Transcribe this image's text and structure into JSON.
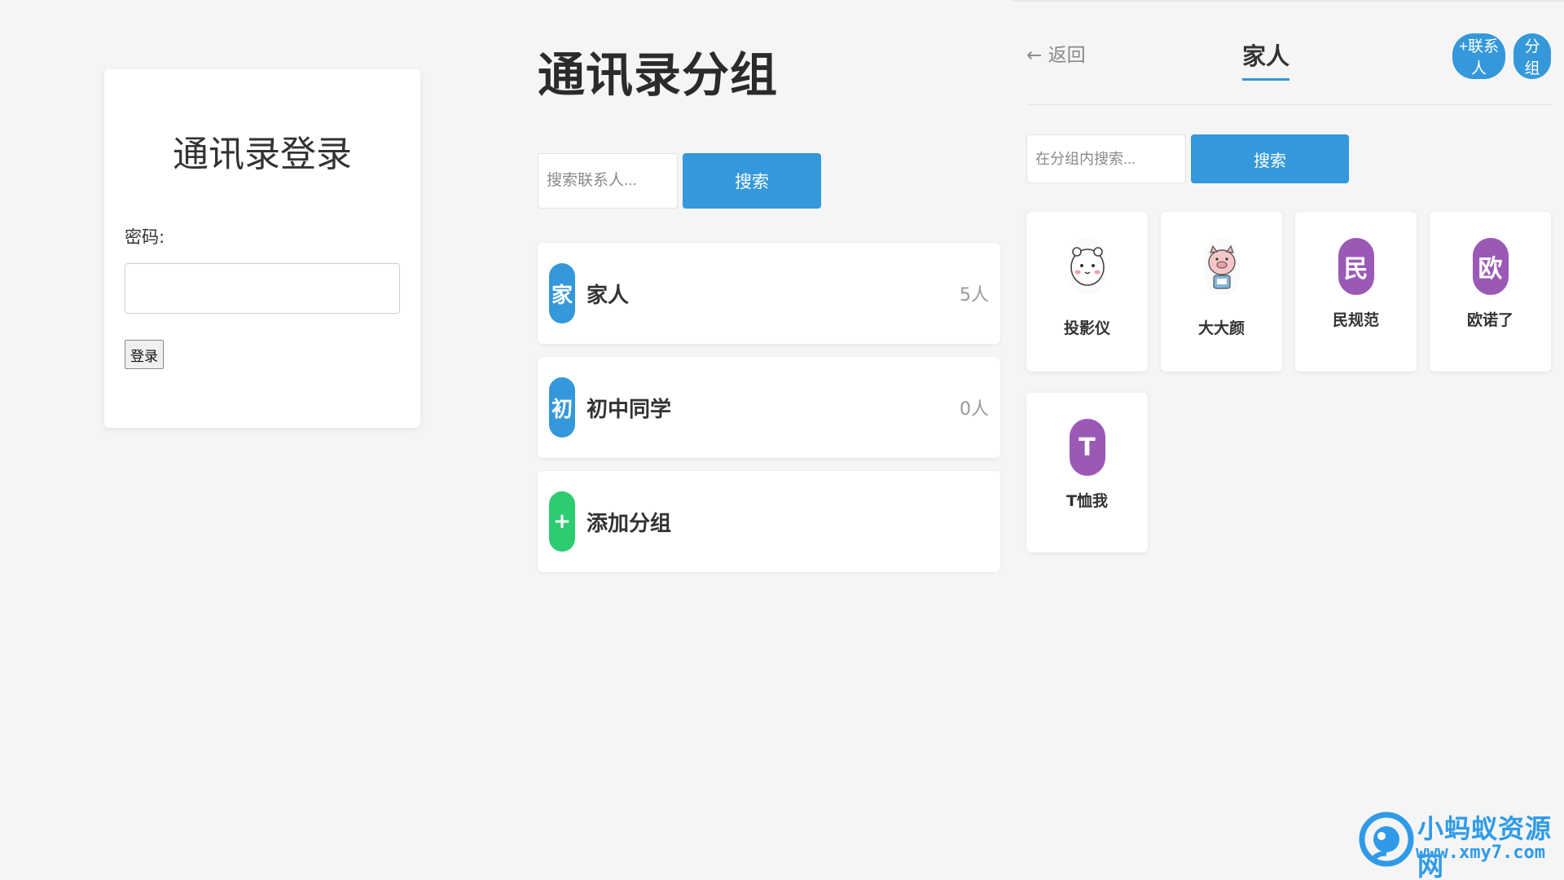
{
  "login": {
    "title": "通讯录登录",
    "password_label": "密码:",
    "password_value": "",
    "login_button": "登录"
  },
  "groups": {
    "title": "通讯录分组",
    "search_placeholder": "搜索联系人...",
    "search_button": "搜索",
    "items": [
      {
        "avatar": "家",
        "name": "家人",
        "count": "5人",
        "color": "#3498db"
      },
      {
        "avatar": "初",
        "name": "初中同学",
        "count": "0人",
        "color": "#3498db"
      },
      {
        "avatar": "+",
        "name": "添加分组",
        "count": "",
        "color": "#2ecc71"
      }
    ]
  },
  "detail": {
    "back": "← 返回",
    "title": "家人",
    "add_contact_button": "+联系人",
    "group_button": "分组",
    "search_placeholder": "在分组内搜索...",
    "search_button": "搜索",
    "contacts": [
      {
        "name": "投影仪",
        "avatar_type": "image",
        "icon": "bear-face-icon"
      },
      {
        "name": "大大颜",
        "avatar_type": "image",
        "icon": "pig-face-icon"
      },
      {
        "name": "民规范",
        "avatar_type": "letter",
        "letter": "民",
        "color": "#9b59b6"
      },
      {
        "name": "欧诺了",
        "avatar_type": "letter",
        "letter": "欧",
        "color": "#9b59b6"
      },
      {
        "name": "T恤我",
        "avatar_type": "letter",
        "letter": "T",
        "color": "#9b59b6"
      }
    ]
  },
  "watermark": {
    "line1": "小蚂蚁资源网",
    "line2": "www.xmy7.com",
    "color": "#2f9be8"
  }
}
